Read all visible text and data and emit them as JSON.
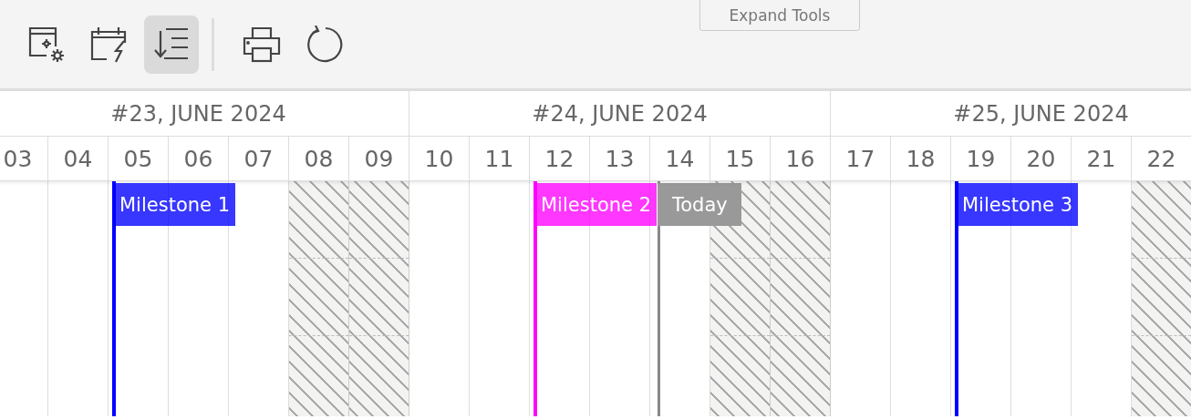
{
  "toolbar": {
    "expand_button": "Expand Tools",
    "items": [
      {
        "kind": "settings",
        "selected": false
      },
      {
        "kind": "calendar-bolt",
        "selected": false
      },
      {
        "kind": "sort",
        "selected": true
      },
      {
        "kind": "separator"
      },
      {
        "kind": "print",
        "selected": false
      },
      {
        "kind": "refresh",
        "selected": false
      }
    ]
  },
  "weeks": [
    "#23, JUNE 2024",
    "#24, JUNE 2024",
    "#25, JUNE 2024"
  ],
  "days": [
    {
      "label": "03",
      "weekend": false
    },
    {
      "label": "04",
      "weekend": false
    },
    {
      "label": "05",
      "weekend": false,
      "milestone": {
        "label": "Milestone 1",
        "color": "#0000ff"
      }
    },
    {
      "label": "06",
      "weekend": false
    },
    {
      "label": "07",
      "weekend": false
    },
    {
      "label": "08",
      "weekend": true
    },
    {
      "label": "09",
      "weekend": true
    },
    {
      "label": "10",
      "weekend": false
    },
    {
      "label": "11",
      "weekend": false
    },
    {
      "label": "12",
      "weekend": false,
      "milestone": {
        "label": "Milestone 2",
        "color": "#ff00ff"
      }
    },
    {
      "label": "13",
      "weekend": false
    },
    {
      "label": "14",
      "weekend": false,
      "today": "Today"
    },
    {
      "label": "15",
      "weekend": true
    },
    {
      "label": "16",
      "weekend": true
    },
    {
      "label": "17",
      "weekend": false
    },
    {
      "label": "18",
      "weekend": false
    },
    {
      "label": "19",
      "weekend": false,
      "milestone": {
        "label": "Milestone 3",
        "color": "#0000ff"
      }
    },
    {
      "label": "20",
      "weekend": false
    },
    {
      "label": "21",
      "weekend": false
    },
    {
      "label": "22",
      "weekend": true
    }
  ]
}
